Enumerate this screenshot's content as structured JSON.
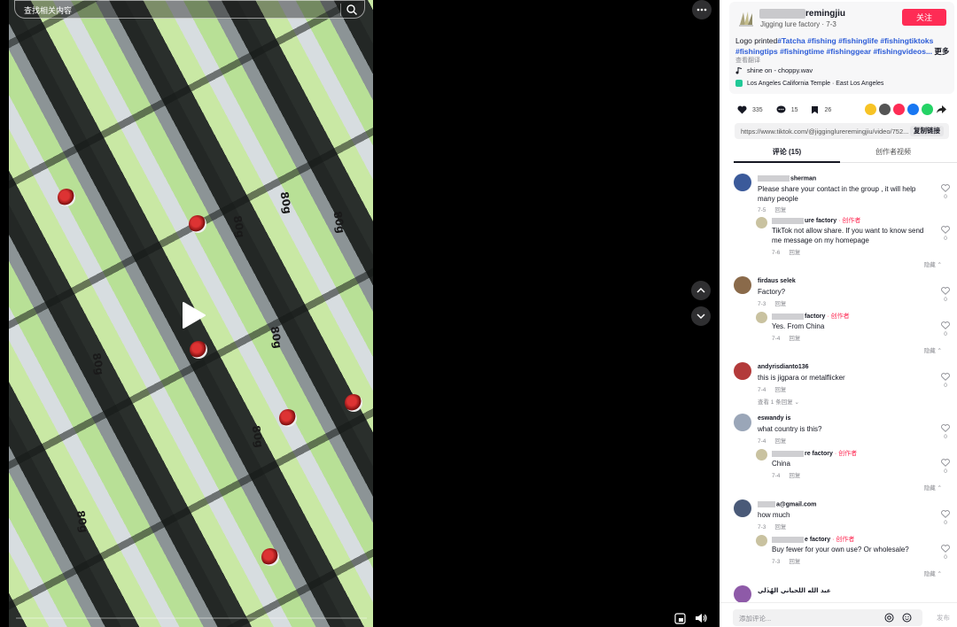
{
  "video": {
    "search_placeholder": "查找相关内容",
    "lure_labels": [
      "80g",
      "80g",
      "80g",
      "80g",
      "80g",
      "80g",
      "80g"
    ]
  },
  "author": {
    "name": "remingjiu",
    "subtitle": "Jigging lure factory · 7-3",
    "follow_label": "关注"
  },
  "caption": {
    "prefix": "Logo printed",
    "tags": [
      "#Tatcha",
      "#fishing",
      "#fishinglife",
      "#fishingtiktoks",
      "#fishingtips",
      "#fishingtime",
      "#fishinggear",
      "#fishingvideos..."
    ],
    "more_label": "更多",
    "translate_label": "查看翻译"
  },
  "music": {
    "label": "shine on - choppy.wav"
  },
  "location": {
    "label": "Los Angeles California Temple · East Los Angeles"
  },
  "stats": {
    "likes": "335",
    "comments": "15",
    "saves": "26"
  },
  "share": {
    "colors": [
      "#f7c325",
      "#555555",
      "#fe2c55",
      "#1877f2",
      "#25d366",
      "#222222"
    ]
  },
  "link": {
    "url": "https://www.tiktok.com/@jigginglureremingjiu/video/752...",
    "copy_label": "复制链接"
  },
  "tabs": {
    "comments": "评论 (15)",
    "creator_videos": "创作者视频"
  },
  "comments": [
    {
      "user": "sherman",
      "text": "Please share your contact in the group , it will help many people",
      "date": "7-5",
      "reply_label": "回复",
      "likes": "0",
      "replies": [
        {
          "user": "ure factory",
          "creator": "· 创作者",
          "text": "TikTok not allow share. If you want to know send me message on my homepage",
          "date": "7-6",
          "reply_label": "回复",
          "likes": "0"
        }
      ],
      "collapse_label": "隐藏"
    },
    {
      "user": "firdaus selek",
      "text": "Factory?",
      "date": "7-3",
      "reply_label": "回复",
      "likes": "0",
      "replies": [
        {
          "user": "factory",
          "creator": "· 创作者",
          "text": "Yes. From China",
          "date": "7-4",
          "reply_label": "回复",
          "likes": "0"
        }
      ],
      "collapse_label": "隐藏"
    },
    {
      "user": "andyrisdianto136",
      "text": "this is jigpara or metalflicker",
      "date": "7-4",
      "reply_label": "回复",
      "likes": "0",
      "view_replies": "查看 1 条回复"
    },
    {
      "user": "eswandy is",
      "text": "what country is this?",
      "date": "7-4",
      "reply_label": "回复",
      "likes": "0",
      "replies": [
        {
          "user": "re factory",
          "creator": "· 创作者",
          "text": "China",
          "date": "7-4",
          "reply_label": "回复",
          "likes": "0"
        }
      ],
      "collapse_label": "隐藏"
    },
    {
      "user": "a@gmail.com",
      "text": "how much",
      "date": "7-3",
      "reply_label": "回复",
      "likes": "0",
      "replies": [
        {
          "user": "e factory",
          "creator": "· 创作者",
          "text": "Buy fewer for your own use? Or wholesale?",
          "date": "7-3",
          "reply_label": "回复",
          "likes": "0"
        }
      ],
      "collapse_label": "隐藏"
    },
    {
      "user": "عبد الله اللحياني الهُذَلي"
    }
  ],
  "comment_box": {
    "placeholder": "添加评论...",
    "post_label": "发布"
  }
}
